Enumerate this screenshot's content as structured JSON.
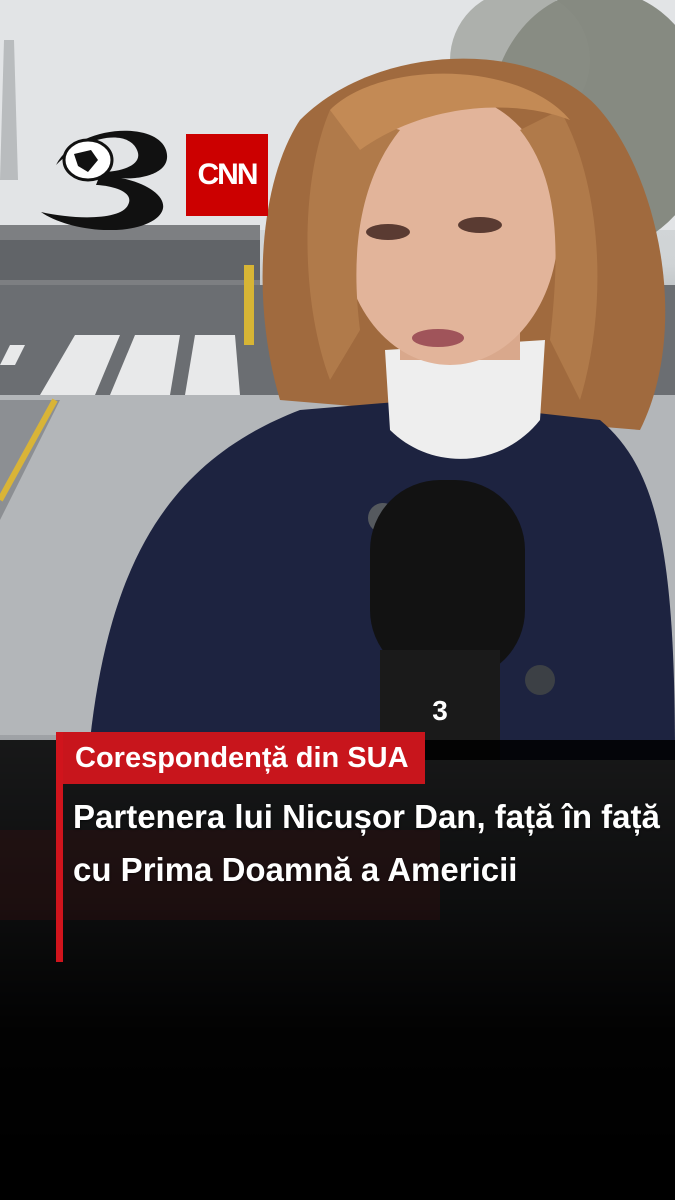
{
  "video": {
    "description_icon": "news-reporter-frame"
  },
  "branding": {
    "channel_logo_icon": "antena3-globe-logo",
    "partner_logo_text": "CNN",
    "partner_logo_color": "#cc0000"
  },
  "lower_third": {
    "tag_label": "Corespondență din SUA",
    "tag_color": "#c8151c",
    "headline": "Partenera lui Nicușor Dan, față în față cu Prima Doamnă a Americii"
  }
}
